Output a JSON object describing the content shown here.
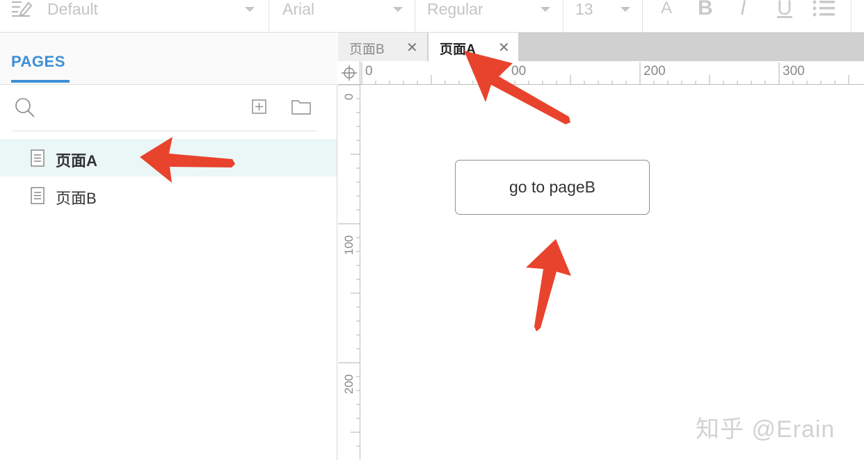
{
  "toolbar": {
    "style": "Default",
    "font_family": "Arial",
    "font_weight": "Regular",
    "font_size": "13",
    "format_buttons": [
      "A",
      "B",
      "I",
      "U"
    ]
  },
  "left_panel": {
    "title": "PAGES",
    "pages": [
      {
        "label": "页面A",
        "selected": true
      },
      {
        "label": "页面B",
        "selected": false
      }
    ]
  },
  "tabs": [
    {
      "label": "页面B",
      "active": false
    },
    {
      "label": "页面A",
      "active": true
    }
  ],
  "ruler": {
    "horizontal": [
      "0",
      "00",
      "200",
      "300"
    ],
    "vertical": [
      "0",
      "100",
      "200"
    ]
  },
  "canvas": {
    "button_label": "go to pageB"
  },
  "watermark": "知乎 @Erain",
  "colors": {
    "accent": "#3d8fd6",
    "selected_bg": "#eaf7f6",
    "arrow": "#e8432c"
  }
}
